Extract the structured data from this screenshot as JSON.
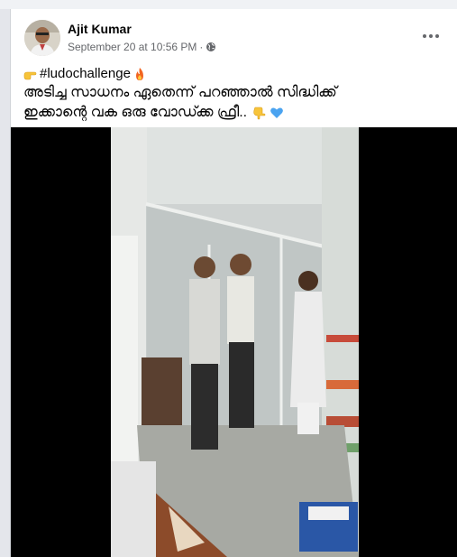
{
  "post": {
    "author": "Ajit Kumar",
    "timestamp": "September 20 at 10:56 PM",
    "separator": "·",
    "privacy_icon": "globe-icon",
    "more_icon": "more-options-icon",
    "text": {
      "hashtag": "#ludochallenge",
      "line2": "അടിച്ച സാധനം ഏതെന്ന് പറഞ്ഞാൽ  സിദ്ധിക്ക്",
      "line3": "ഇക്കാന്റെ വക ഒരു വോഡ്ക്ക ഫ്രീ.."
    },
    "emojis": [
      "pointing-right-emoji",
      "fire-emoji",
      "pointing-down-emoji",
      "blue-heart-emoji"
    ],
    "media": {
      "type": "video",
      "icon": "video-frame"
    }
  },
  "colors": {
    "page_bg": "#e4e6eb",
    "card_bg": "#ffffff",
    "text_primary": "#050505",
    "text_secondary": "#65676b",
    "heart_blue": "#4aa3f0"
  }
}
